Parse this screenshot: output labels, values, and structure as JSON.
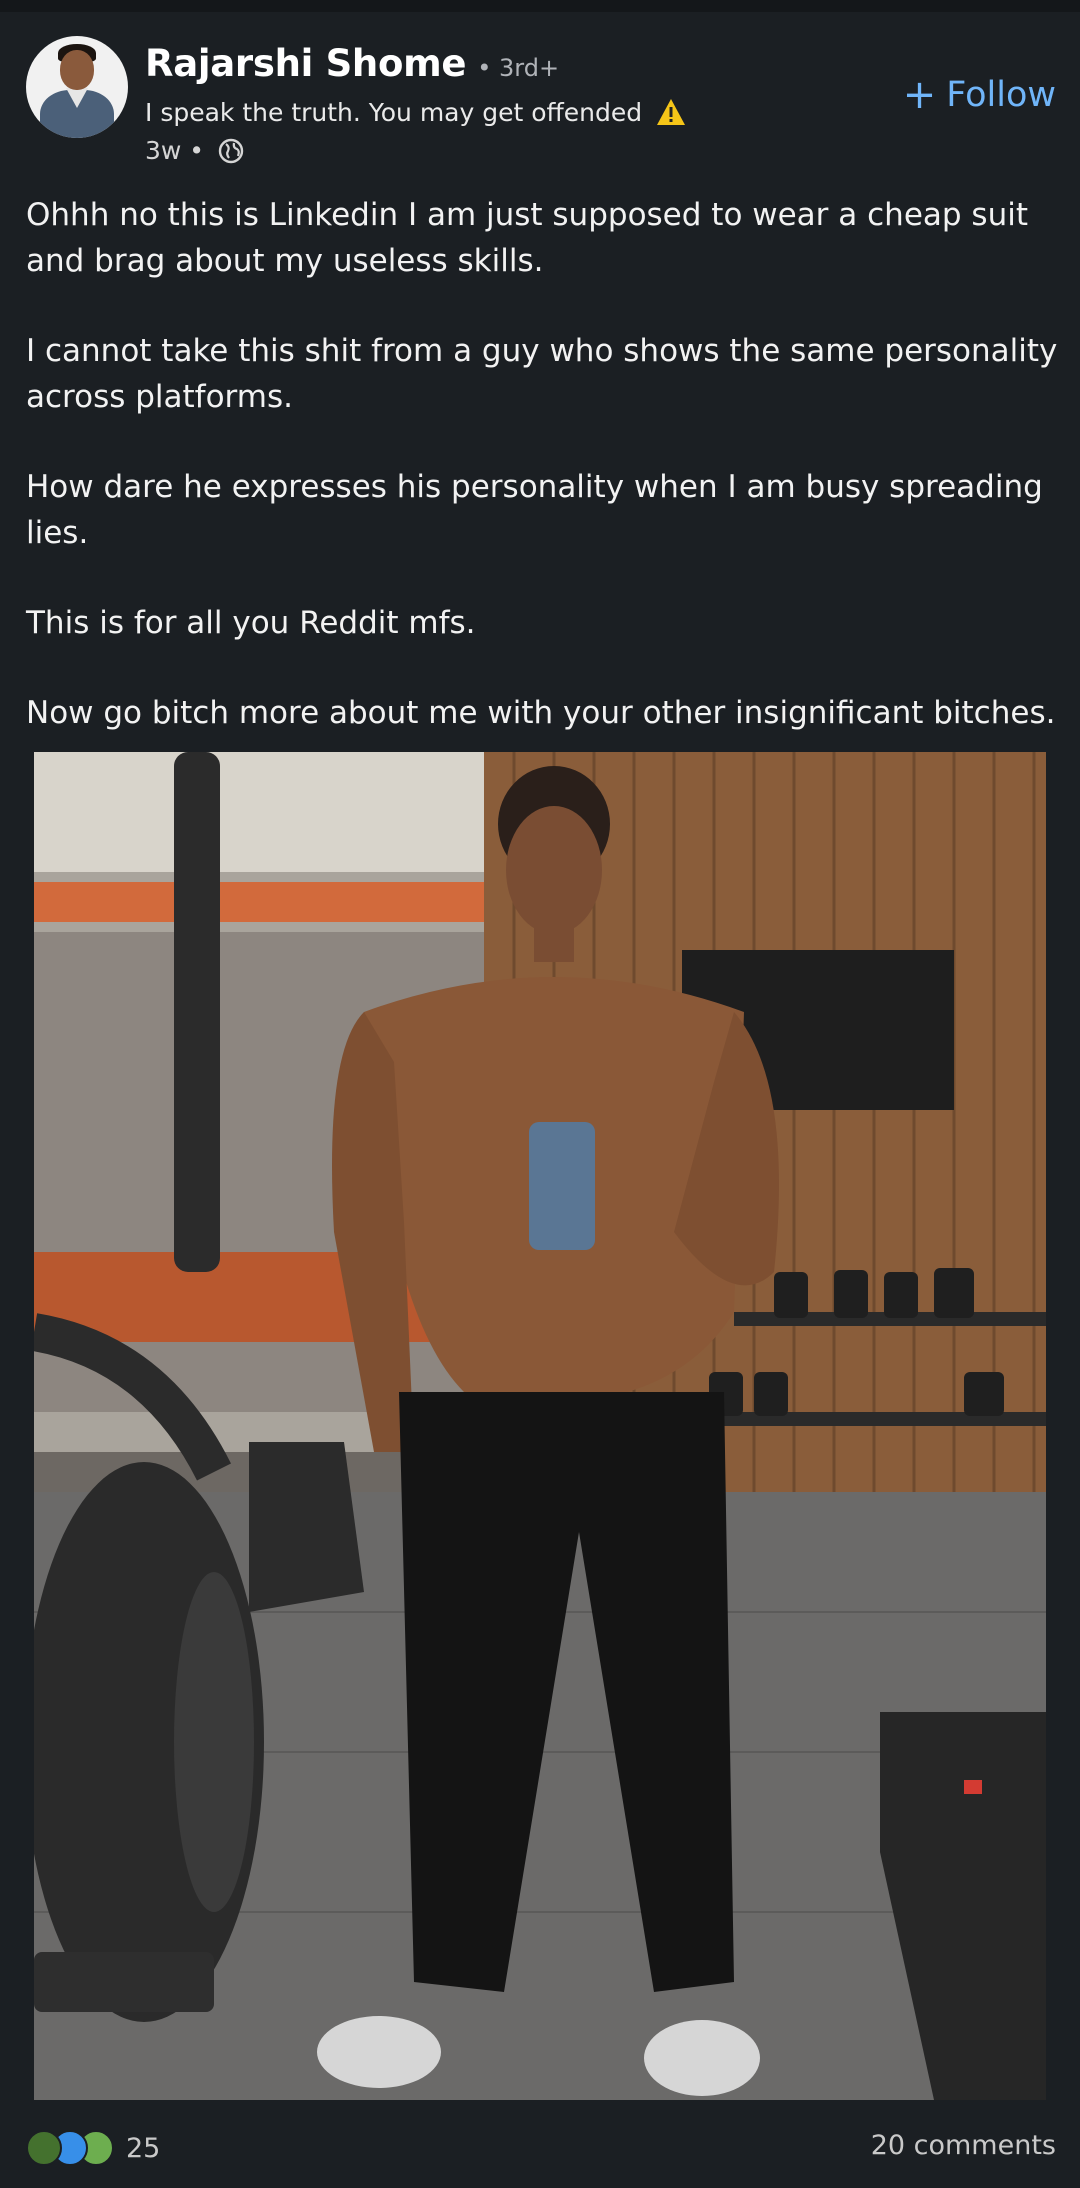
{
  "author": {
    "name": "Rajarshi Shome",
    "degree": "• 3rd+",
    "headline": "I speak the truth. You may get offended",
    "headline_icon": "warning-icon",
    "time": "3w •",
    "visibility_icon": "globe-icon"
  },
  "follow": {
    "plus": "+",
    "label": "Follow",
    "color": "#70b5f9"
  },
  "post": {
    "paragraphs": [
      "Ohhh no this is Linkedin I am just supposed to wear a cheap suit and brag about my useless skills.",
      "I cannot take this shit from a guy who shows the same personality across platforms.",
      "How dare he expresses his personality when I am busy spreading lies.",
      "This is for all you Reddit mfs.",
      "Now go bitch more about me with your other insignificant bitches."
    ]
  },
  "footer": {
    "reaction_icons": [
      "celebrate-icon",
      "like-icon",
      "support-icon"
    ],
    "reaction_count": "25",
    "comments": "20 comments"
  },
  "colors": {
    "background": "#1b1f23",
    "link": "#70b5f9",
    "text": "#f2f2f2"
  }
}
